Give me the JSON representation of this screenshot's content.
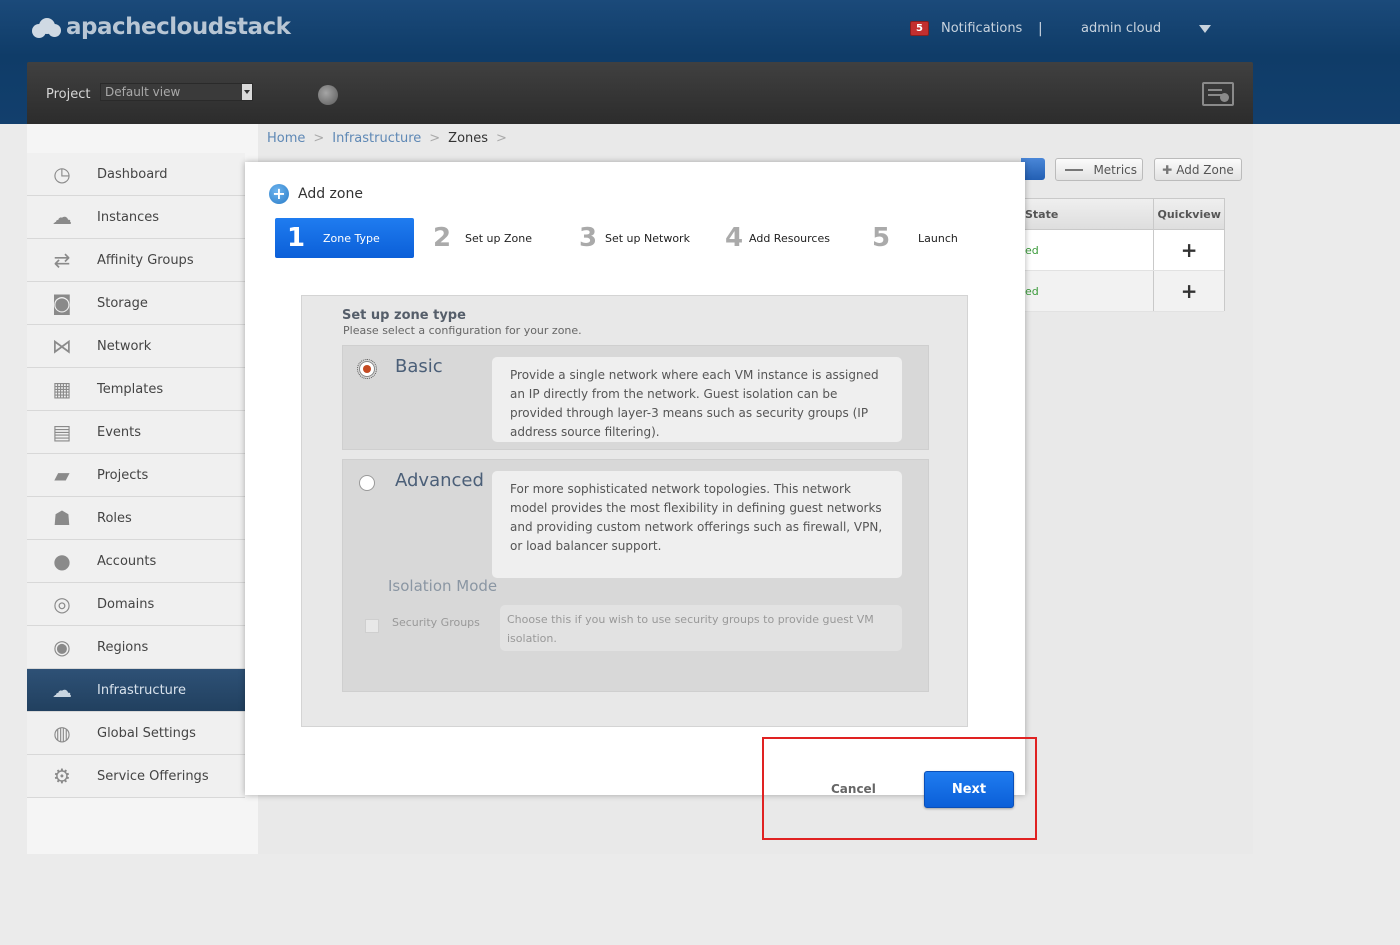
{
  "header": {
    "logo_text": "apachecloudstack",
    "notifications_count": "5",
    "notifications_label": "Notifications",
    "separator": "|",
    "user_name": "admin cloud"
  },
  "project_bar": {
    "label": "Project",
    "select_value": "Default view"
  },
  "sidebar": {
    "items": [
      {
        "label": "Dashboard",
        "icon": "dashboard-icon"
      },
      {
        "label": "Instances",
        "icon": "cloud-icon"
      },
      {
        "label": "Affinity Groups",
        "icon": "affinity-icon"
      },
      {
        "label": "Storage",
        "icon": "storage-icon"
      },
      {
        "label": "Network",
        "icon": "network-icon"
      },
      {
        "label": "Templates",
        "icon": "templates-icon"
      },
      {
        "label": "Events",
        "icon": "calendar-icon"
      },
      {
        "label": "Projects",
        "icon": "folder-icon"
      },
      {
        "label": "Roles",
        "icon": "roles-icon"
      },
      {
        "label": "Accounts",
        "icon": "user-icon"
      },
      {
        "label": "Domains",
        "icon": "domains-icon"
      },
      {
        "label": "Regions",
        "icon": "globe-icon"
      },
      {
        "label": "Infrastructure",
        "icon": "infrastructure-icon",
        "active": true
      },
      {
        "label": "Global Settings",
        "icon": "settings-globe-icon"
      },
      {
        "label": "Service Offerings",
        "icon": "gear-icon"
      }
    ]
  },
  "breadcrumb": {
    "items": [
      "Home",
      "Infrastructure",
      "Zones"
    ],
    "separator": ">"
  },
  "toolbar": {
    "metrics_label": "Metrics",
    "add_zone_label": "Add Zone"
  },
  "grid": {
    "headers": [
      "State",
      "Quickview"
    ],
    "rows": [
      {
        "state": "ed",
        "quickview": "+"
      },
      {
        "state": "ed",
        "quickview": "+"
      }
    ]
  },
  "dialog": {
    "title": "Add zone",
    "steps": [
      {
        "num": "1",
        "label": "Zone Type",
        "active": true
      },
      {
        "num": "2",
        "label": "Set up Zone"
      },
      {
        "num": "3",
        "label": "Set up Network"
      },
      {
        "num": "4",
        "label": "Add Resources"
      },
      {
        "num": "5",
        "label": "Launch"
      }
    ],
    "section_title": "Set up zone type",
    "section_subtitle": "Please select a configuration for your zone.",
    "options": {
      "basic": {
        "name": "Basic",
        "selected": true,
        "description": "Provide a single network where each VM instance is assigned an IP directly from the network. Guest isolation can be provided through layer-3 means such as security groups (IP address source filtering)."
      },
      "advanced": {
        "name": "Advanced",
        "selected": false,
        "description": "For more sophisticated network topologies. This network model provides the most flexibility in defining guest networks and providing custom network offerings such as firewall, VPN, or load balancer support."
      }
    },
    "isolation": {
      "title": "Isolation Mode",
      "checkbox_label": "Security Groups",
      "checkbox_desc": "Choose this if you wish to use security groups to provide guest VM isolation."
    },
    "cancel_label": "Cancel",
    "next_label": "Next"
  },
  "colors": {
    "accent_blue": "#0b5fd8",
    "header_blue": "#123f6d",
    "highlight_red": "#e02222",
    "radio_selected": "#c44a22"
  }
}
